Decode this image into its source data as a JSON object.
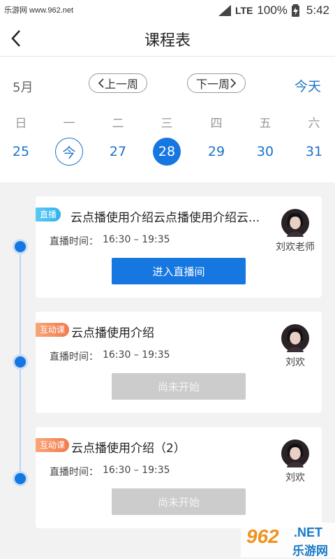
{
  "status_bar": {
    "watermark_text": "乐游网 www.962.net",
    "network": "LTE",
    "battery": "100%",
    "time": "5:42"
  },
  "header": {
    "title": "课程表"
  },
  "calendar": {
    "month": "5月",
    "prev_week": "上一周",
    "next_week": "下一周",
    "today": "今天",
    "weekdays": [
      "日",
      "一",
      "二",
      "三",
      "四",
      "五",
      "六"
    ],
    "dates": [
      "25",
      "今",
      "27",
      "28",
      "29",
      "30",
      "31"
    ],
    "selected_index": 3,
    "today_index": 1
  },
  "courses": [
    {
      "tag": "直播",
      "title": "云点播使用介绍云点播使用介绍云...",
      "time_label": "直播时间：",
      "time": "16:30 – 19:35",
      "teacher": "刘欢老师",
      "button": "进入直播间"
    },
    {
      "tag": "互动课",
      "title": "云点播使用介绍",
      "time_label": "直播时间：",
      "time": "16:30 – 19:35",
      "teacher": "刘欢",
      "button": "尚未开始"
    },
    {
      "tag": "互动课",
      "title": "云点播使用介绍（2）",
      "time_label": "直播时间：",
      "time": "16:30 – 19:35",
      "teacher": "刘欢",
      "button": "尚未开始"
    }
  ],
  "watermark": {
    "number": "962",
    "net": ".NET",
    "site": "乐游网"
  },
  "colors": {
    "accent": "#1677e0",
    "live_tag": "#2eb2f0",
    "interactive_tag": "#f27a4b",
    "disabled": "#cccccc"
  }
}
